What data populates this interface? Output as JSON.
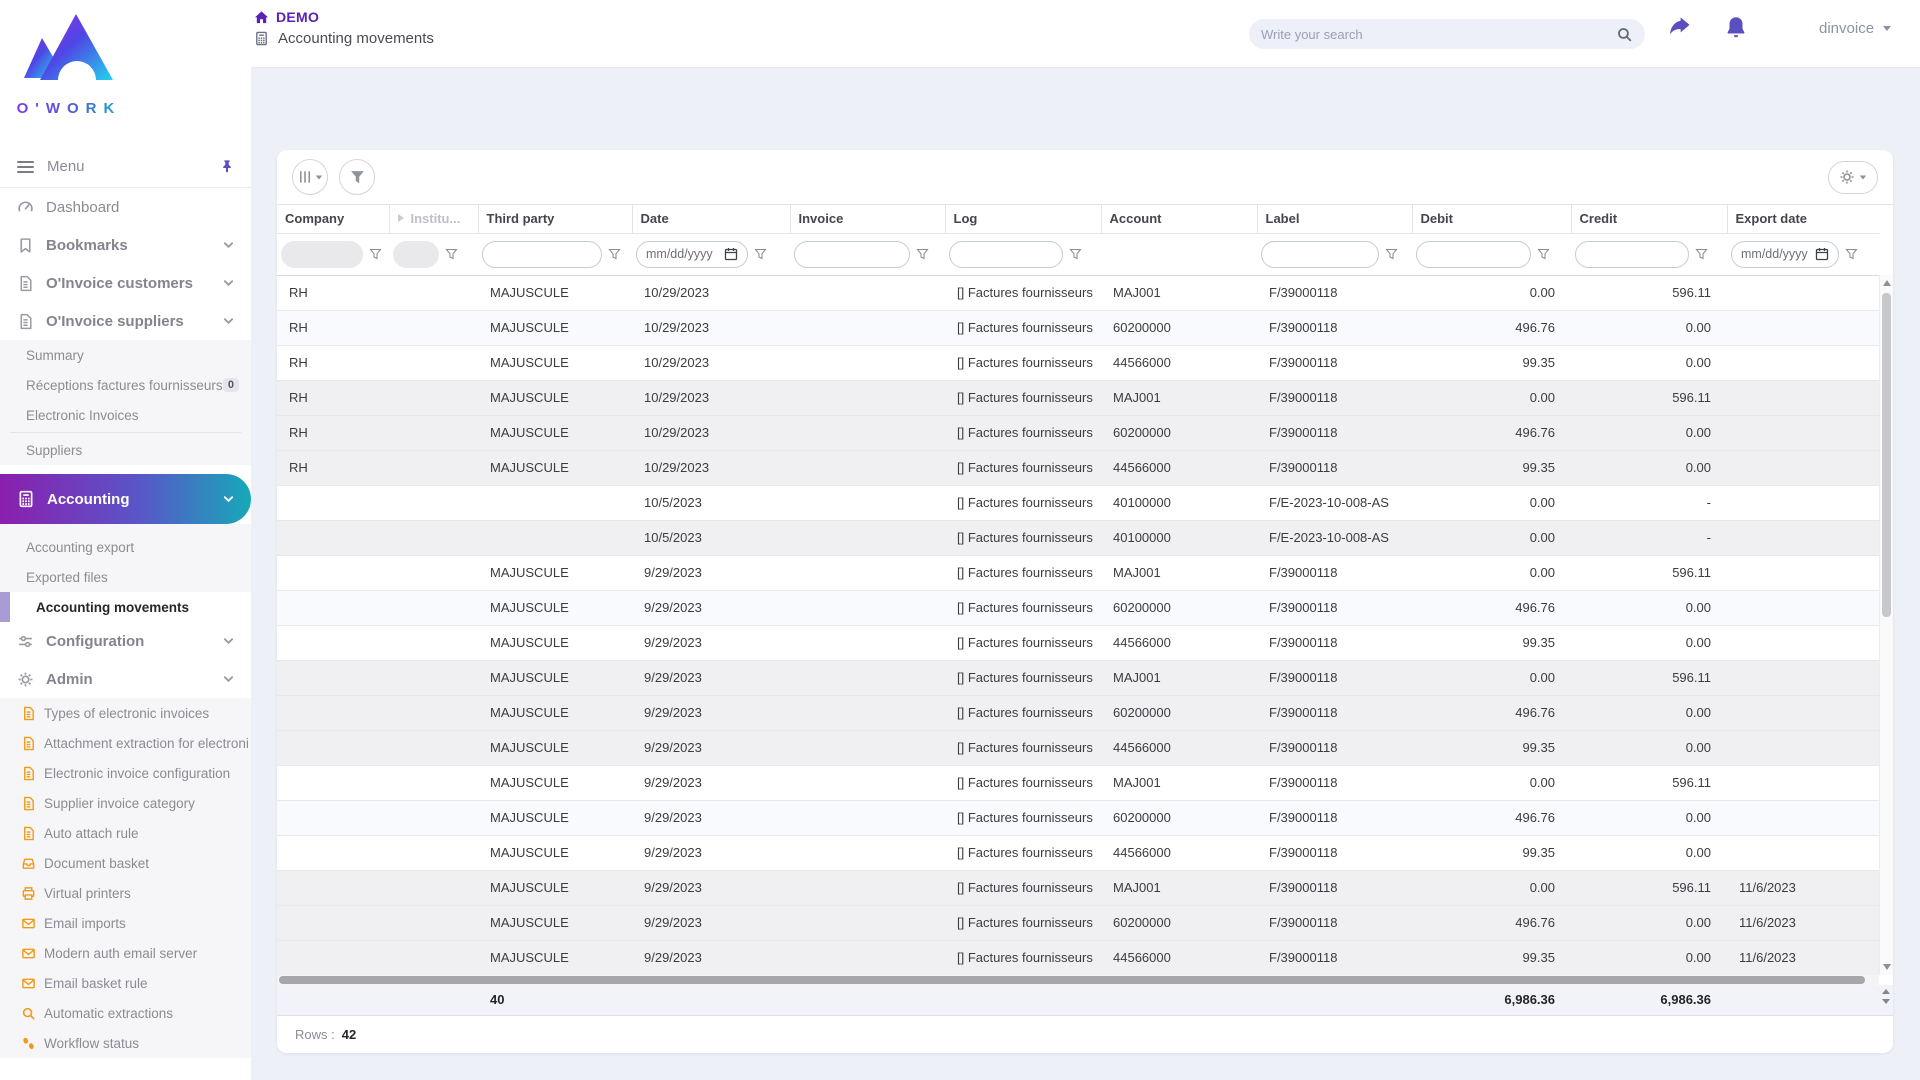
{
  "brand": {
    "name": "O'WORK"
  },
  "topbar": {
    "app_label": "DEMO",
    "page_title": "Accounting movements",
    "search_placeholder": "Write your search",
    "username": "dinvoice"
  },
  "sidebar": {
    "menu_label": "Menu",
    "dashboard": "Dashboard",
    "bookmarks": "Bookmarks",
    "oinvoice_customers": "O'Invoice customers",
    "oinvoice_suppliers": "O'Invoice suppliers",
    "summary": "Summary",
    "receptions": "Réceptions factures fournisseurs",
    "receptions_badge": "0",
    "electronic_invoices": "Electronic Invoices",
    "suppliers": "Suppliers",
    "accounting": "Accounting",
    "accounting_export": "Accounting export",
    "exported_files": "Exported files",
    "accounting_movements": "Accounting movements",
    "configuration": "Configuration",
    "admin": "Admin",
    "admin_items": [
      "Types of electronic invoices",
      "Attachment extraction for electroni",
      "Electronic invoice configuration",
      "Supplier invoice category",
      "Auto attach rule",
      "Document basket",
      "Virtual printers",
      "Email imports",
      "Modern auth email server",
      "Email basket rule",
      "Automatic extractions",
      "Workflow status"
    ]
  },
  "table": {
    "columns": {
      "company": "Company",
      "institution": "Institu...",
      "third_party": "Third party",
      "date": "Date",
      "invoice": "Invoice",
      "log": "Log",
      "account": "Account",
      "label": "Label",
      "debit": "Debit",
      "credit": "Credit",
      "export_date": "Export date"
    },
    "date_placeholder": "mm/dd/yyyy",
    "rows": [
      {
        "company": "RH",
        "third_party": "MAJUSCULE",
        "date": "10/29/2023",
        "invoice": "",
        "log": "[] Factures fournisseurs",
        "account": "MAJ001",
        "label": "F/39000118",
        "debit": "0.00",
        "credit": "596.11",
        "export_date": "",
        "shade": "white"
      },
      {
        "company": "RH",
        "third_party": "MAJUSCULE",
        "date": "10/29/2023",
        "invoice": "",
        "log": "[] Factures fournisseurs",
        "account": "60200000",
        "label": "F/39000118",
        "debit": "496.76",
        "credit": "0.00",
        "export_date": "",
        "shade": "tint"
      },
      {
        "company": "RH",
        "third_party": "MAJUSCULE",
        "date": "10/29/2023",
        "invoice": "",
        "log": "[] Factures fournisseurs",
        "account": "44566000",
        "label": "F/39000118",
        "debit": "99.35",
        "credit": "0.00",
        "export_date": "",
        "shade": "white"
      },
      {
        "company": "RH",
        "third_party": "MAJUSCULE",
        "date": "10/29/2023",
        "invoice": "",
        "log": "[] Factures fournisseurs",
        "account": "MAJ001",
        "label": "F/39000118",
        "debit": "0.00",
        "credit": "596.11",
        "export_date": "",
        "shade": "gray"
      },
      {
        "company": "RH",
        "third_party": "MAJUSCULE",
        "date": "10/29/2023",
        "invoice": "",
        "log": "[] Factures fournisseurs",
        "account": "60200000",
        "label": "F/39000118",
        "debit": "496.76",
        "credit": "0.00",
        "export_date": "",
        "shade": "gray"
      },
      {
        "company": "RH",
        "third_party": "MAJUSCULE",
        "date": "10/29/2023",
        "invoice": "",
        "log": "[] Factures fournisseurs",
        "account": "44566000",
        "label": "F/39000118",
        "debit": "99.35",
        "credit": "0.00",
        "export_date": "",
        "shade": "gray"
      },
      {
        "company": "",
        "third_party": "",
        "date": "10/5/2023",
        "invoice": "",
        "log": "[] Factures fournisseurs",
        "account": "40100000",
        "label": "F/E-2023-10-008-AS",
        "debit": "0.00",
        "credit": "-",
        "export_date": "",
        "shade": "white"
      },
      {
        "company": "",
        "third_party": "",
        "date": "10/5/2023",
        "invoice": "",
        "log": "[] Factures fournisseurs",
        "account": "40100000",
        "label": "F/E-2023-10-008-AS",
        "debit": "0.00",
        "credit": "-",
        "export_date": "",
        "shade": "gray"
      },
      {
        "company": "",
        "third_party": "MAJUSCULE",
        "date": "9/29/2023",
        "invoice": "",
        "log": "[] Factures fournisseurs",
        "account": "MAJ001",
        "label": "F/39000118",
        "debit": "0.00",
        "credit": "596.11",
        "export_date": "",
        "shade": "white"
      },
      {
        "company": "",
        "third_party": "MAJUSCULE",
        "date": "9/29/2023",
        "invoice": "",
        "log": "[] Factures fournisseurs",
        "account": "60200000",
        "label": "F/39000118",
        "debit": "496.76",
        "credit": "0.00",
        "export_date": "",
        "shade": "tint"
      },
      {
        "company": "",
        "third_party": "MAJUSCULE",
        "date": "9/29/2023",
        "invoice": "",
        "log": "[] Factures fournisseurs",
        "account": "44566000",
        "label": "F/39000118",
        "debit": "99.35",
        "credit": "0.00",
        "export_date": "",
        "shade": "white"
      },
      {
        "company": "",
        "third_party": "MAJUSCULE",
        "date": "9/29/2023",
        "invoice": "",
        "log": "[] Factures fournisseurs",
        "account": "MAJ001",
        "label": "F/39000118",
        "debit": "0.00",
        "credit": "596.11",
        "export_date": "",
        "shade": "gray"
      },
      {
        "company": "",
        "third_party": "MAJUSCULE",
        "date": "9/29/2023",
        "invoice": "",
        "log": "[] Factures fournisseurs",
        "account": "60200000",
        "label": "F/39000118",
        "debit": "496.76",
        "credit": "0.00",
        "export_date": "",
        "shade": "gray"
      },
      {
        "company": "",
        "third_party": "MAJUSCULE",
        "date": "9/29/2023",
        "invoice": "",
        "log": "[] Factures fournisseurs",
        "account": "44566000",
        "label": "F/39000118",
        "debit": "99.35",
        "credit": "0.00",
        "export_date": "",
        "shade": "gray"
      },
      {
        "company": "",
        "third_party": "MAJUSCULE",
        "date": "9/29/2023",
        "invoice": "",
        "log": "[] Factures fournisseurs",
        "account": "MAJ001",
        "label": "F/39000118",
        "debit": "0.00",
        "credit": "596.11",
        "export_date": "",
        "shade": "white"
      },
      {
        "company": "",
        "third_party": "MAJUSCULE",
        "date": "9/29/2023",
        "invoice": "",
        "log": "[] Factures fournisseurs",
        "account": "60200000",
        "label": "F/39000118",
        "debit": "496.76",
        "credit": "0.00",
        "export_date": "",
        "shade": "tint"
      },
      {
        "company": "",
        "third_party": "MAJUSCULE",
        "date": "9/29/2023",
        "invoice": "",
        "log": "[] Factures fournisseurs",
        "account": "44566000",
        "label": "F/39000118",
        "debit": "99.35",
        "credit": "0.00",
        "export_date": "",
        "shade": "white"
      },
      {
        "company": "",
        "third_party": "MAJUSCULE",
        "date": "9/29/2023",
        "invoice": "",
        "log": "[] Factures fournisseurs",
        "account": "MAJ001",
        "label": "F/39000118",
        "debit": "0.00",
        "credit": "596.11",
        "export_date": "11/6/2023",
        "shade": "gray"
      },
      {
        "company": "",
        "third_party": "MAJUSCULE",
        "date": "9/29/2023",
        "invoice": "",
        "log": "[] Factures fournisseurs",
        "account": "60200000",
        "label": "F/39000118",
        "debit": "496.76",
        "credit": "0.00",
        "export_date": "11/6/2023",
        "shade": "gray"
      },
      {
        "company": "",
        "third_party": "MAJUSCULE",
        "date": "9/29/2023",
        "invoice": "",
        "log": "[] Factures fournisseurs",
        "account": "44566000",
        "label": "F/39000118",
        "debit": "99.35",
        "credit": "0.00",
        "export_date": "11/6/2023",
        "shade": "gray"
      }
    ],
    "totals": {
      "third_party": "40",
      "debit": "6,986.36",
      "credit": "6,986.36"
    },
    "rows_label": "Rows :",
    "rows_count": "42"
  },
  "colors": {
    "accent_purple": "#5b4fc0",
    "gradient_start": "#8a1fae",
    "gradient_end": "#17a9b8",
    "admin_icon_orange": "#f09a16"
  }
}
